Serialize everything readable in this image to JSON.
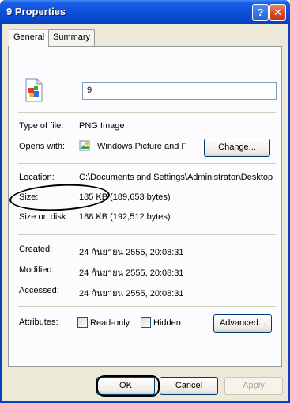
{
  "window": {
    "title": "9 Properties",
    "help_glyph": "?",
    "close_glyph": "✕"
  },
  "tabs": [
    {
      "label": "General"
    },
    {
      "label": "Summary"
    }
  ],
  "file": {
    "name": "9",
    "icon": "png-image-icon"
  },
  "info": {
    "type_label": "Type of file:",
    "type_value": "PNG Image",
    "opens_label": "Opens with:",
    "opens_value": "Windows Picture and F",
    "change_button": "Change...",
    "location_label": "Location:",
    "location_value": "C:\\Documents and Settings\\Administrator\\Desktop",
    "size_label": "Size:",
    "size_value": "185 KB (189,653 bytes)",
    "size_disk_label": "Size on disk:",
    "size_disk_value": "188 KB (192,512 bytes)",
    "created_label": "Created:",
    "created_value": "24 กันยายน 2555, 20:08:31",
    "modified_label": "Modified:",
    "modified_value": "24 กันยายน 2555, 20:08:31",
    "accessed_label": "Accessed:",
    "accessed_value": "24 กันยายน 2555, 20:08:31",
    "attributes_label": "Attributes:",
    "readonly_label": "Read-only",
    "readonly_checked": false,
    "hidden_label": "Hidden",
    "hidden_checked": false,
    "advanced_button": "Advanced..."
  },
  "buttons": {
    "ok": "OK",
    "cancel": "Cancel",
    "apply": "Apply"
  }
}
